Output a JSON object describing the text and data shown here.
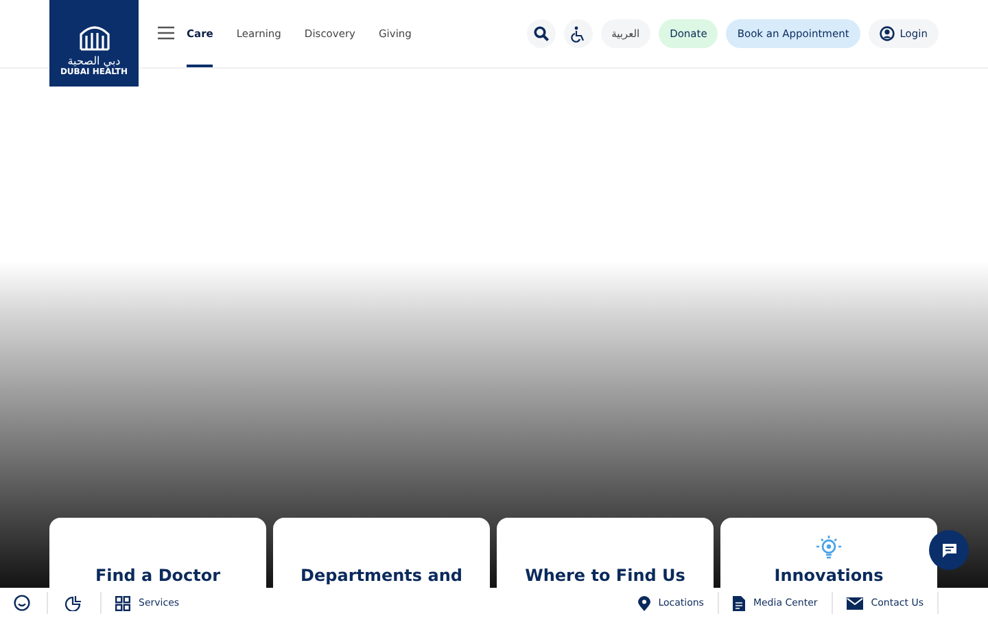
{
  "logo": {
    "arabic": "دبي الصحية",
    "english": "DUBAI HEALTH"
  },
  "nav": [
    {
      "label": "Care",
      "selected": true
    },
    {
      "label": "Learning",
      "selected": false
    },
    {
      "label": "Discovery",
      "selected": false
    },
    {
      "label": "Giving",
      "selected": false
    }
  ],
  "actions": {
    "language": "العربية",
    "donate": "Donate",
    "book": "Book an Appointment",
    "login": "Login"
  },
  "cards": [
    {
      "title": "Find a Doctor",
      "icon": false
    },
    {
      "title": "Departments and",
      "icon": false
    },
    {
      "title": "Where to Find Us",
      "icon": false
    },
    {
      "title": "Innovations",
      "icon": true
    }
  ],
  "bottom_bar": {
    "left": [
      {
        "label": "Services"
      }
    ],
    "right": [
      {
        "label": "Locations",
        "kind": "pin"
      },
      {
        "label": "Media Center",
        "kind": "doc"
      },
      {
        "label": "Contact Us",
        "kind": "mail"
      }
    ]
  }
}
